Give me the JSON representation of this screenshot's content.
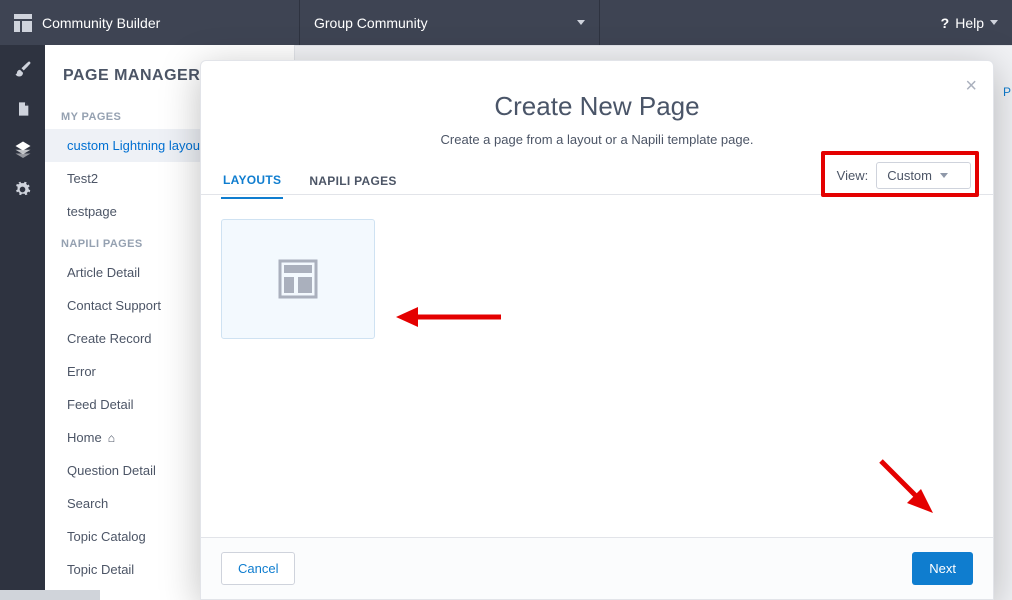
{
  "topbar": {
    "app_name": "Community Builder",
    "community_name": "Group Community",
    "help_label": "Help"
  },
  "sidepanel": {
    "title": "PAGE MANAGER",
    "sections": {
      "my_pages_label": "MY PAGES",
      "napili_pages_label": "NAPILI PAGES"
    },
    "my_pages": [
      {
        "label": "custom Lightning layout",
        "selected": true
      },
      {
        "label": "Test2",
        "selected": false
      },
      {
        "label": "testpage",
        "selected": false
      }
    ],
    "napili_pages": [
      {
        "label": "Article Detail"
      },
      {
        "label": "Contact Support"
      },
      {
        "label": "Create Record"
      },
      {
        "label": "Error"
      },
      {
        "label": "Feed Detail"
      },
      {
        "label": "Home",
        "is_home": true
      },
      {
        "label": "Question Detail"
      },
      {
        "label": "Search"
      },
      {
        "label": "Topic Catalog"
      },
      {
        "label": "Topic Detail"
      }
    ]
  },
  "modal": {
    "title": "Create New Page",
    "subtitle": "Create a page from a layout or a Napili template page.",
    "tabs": {
      "layouts": "LAYOUTS",
      "napili": "NAPILI PAGES"
    },
    "view_label": "View:",
    "view_value": "Custom",
    "cancel": "Cancel",
    "next": "Next"
  },
  "misc": {
    "p_letter": "P"
  }
}
